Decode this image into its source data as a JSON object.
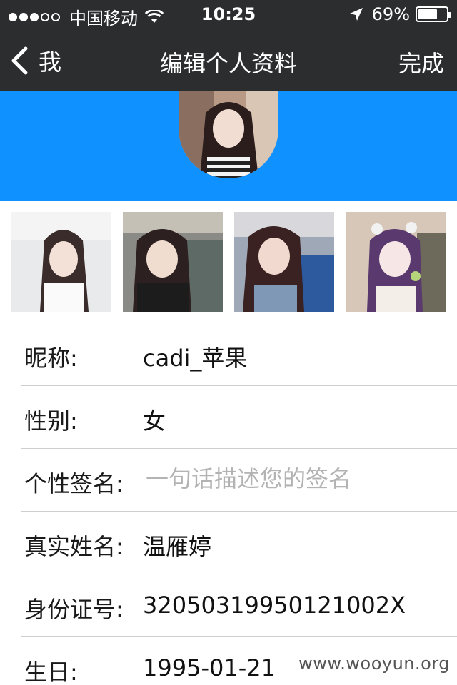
{
  "status_bar": {
    "signal_dots_filled": 3,
    "signal_dots_total": 5,
    "carrier": "中国移动",
    "time": "10:25",
    "battery_percent_text": "69%",
    "battery_level": 0.69,
    "icons": [
      "wifi-icon",
      "location-arrow-icon",
      "battery-icon"
    ]
  },
  "nav": {
    "back_label": "我",
    "title": "编辑个人资料",
    "done_label": "完成"
  },
  "colors": {
    "nav_background": "#2b2d2e",
    "banner_background": "#0f91ff",
    "divider": "#cfcfcf",
    "placeholder": "#b3b3b3"
  },
  "profile": {
    "rows": [
      {
        "label": "昵称:",
        "value": "cadi_苹果"
      },
      {
        "label": "性别:",
        "value": "女"
      },
      {
        "label": "个性签名:",
        "value": "",
        "placeholder": "一句话描述您的签名"
      },
      {
        "label": "真实姓名:",
        "value": "温雁婷"
      },
      {
        "label": "身份证号:",
        "value": "32050319950121002X"
      },
      {
        "label": "生日:",
        "value": "1995-01-21"
      }
    ]
  },
  "watermark": "www.wooyun.org"
}
